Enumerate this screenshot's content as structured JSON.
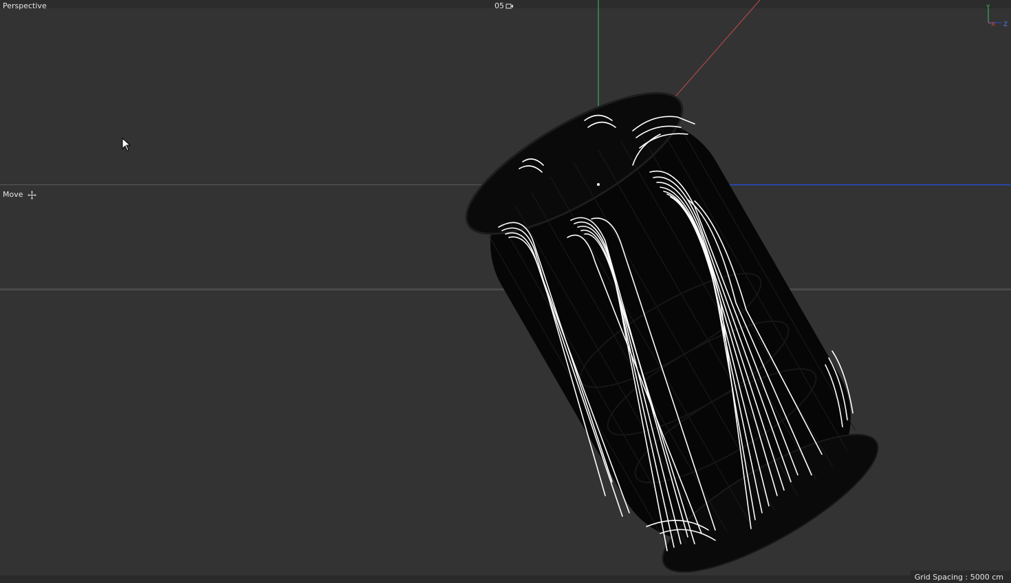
{
  "viewport": {
    "view_name": "Perspective",
    "camera_label": "05",
    "camera_icon": "camera-icon",
    "active_tool": "Move",
    "tool_icon": "move-icon",
    "grid_spacing": "Grid Spacing : 5000 cm"
  },
  "axis_gizmo": {
    "y_label": "Y",
    "x_label": "X",
    "z_label": "Z"
  },
  "colors": {
    "background": "#333333",
    "axis_x": "#c84a4a",
    "axis_y": "#3fc06a",
    "axis_z": "#2a4dd0",
    "wireframe": "#000000",
    "spline": "#ffffff"
  }
}
